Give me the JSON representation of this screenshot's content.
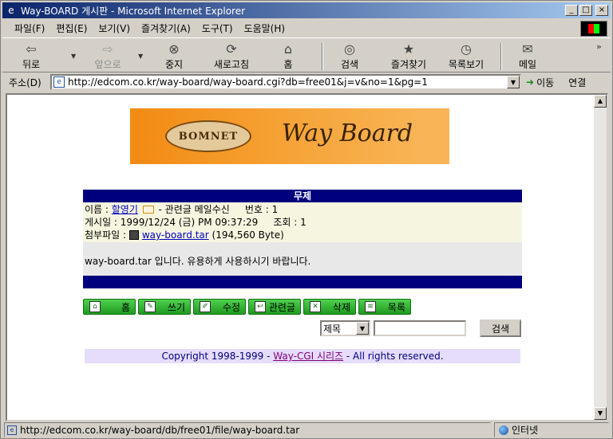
{
  "window": {
    "title": "Way-BOARD 게시판 - Microsoft Internet Explorer",
    "minimize": "_",
    "maximize": "□",
    "close": "×"
  },
  "menu": [
    "파일(F)",
    "편집(E)",
    "보기(V)",
    "즐겨찾기(A)",
    "도구(T)",
    "도움말(H)"
  ],
  "toolbar": {
    "back": "뒤로",
    "forward": "앞으로",
    "stop": "중지",
    "refresh": "새로고침",
    "home": "홈",
    "search": "검색",
    "favorites": "즐겨찾기",
    "history": "목록보기",
    "mail": "메일"
  },
  "address": {
    "label": "주소(D)",
    "url": "http://edcom.co.kr/way-board/way-board.cgi?db=free01&j=v&no=1&pg=1",
    "go": "이동",
    "links": "연결"
  },
  "banner": {
    "logo_text": "BOMNET",
    "title": "Way Board"
  },
  "post": {
    "header": "무제",
    "name_label": "이름 : ",
    "name": "할영기",
    "reply_mail": " - 관련글 메일수신",
    "number_label": "번호 : ",
    "number": "1",
    "date_label": "게시일 : ",
    "date": "1999/12/24 (금) PM 09:37:29",
    "views_label": "조회 : ",
    "views": "1",
    "attach_label": "첨부파일 : ",
    "attach_file": "way-board.tar",
    "attach_size": "(194,560 Byte)",
    "body": "way-board.tar 입니다. 유용하게 사용하시기 바랍니다."
  },
  "buttons": {
    "home": "홈",
    "write": "쓰기",
    "edit": "수정",
    "related": "관련글",
    "delete": "삭제",
    "list": "목록"
  },
  "search": {
    "field_selected": "제목",
    "query": "",
    "button": "검색"
  },
  "footer": {
    "copyright_prefix": "Copyright 1998-1999 - ",
    "series_link": "Way-CGI 시리즈",
    "copyright_suffix": " - All rights reserved."
  },
  "status": {
    "url": "http://edcom.co.kr/way-board/db/free01/file/way-board.tar",
    "zone": "인터넷"
  }
}
